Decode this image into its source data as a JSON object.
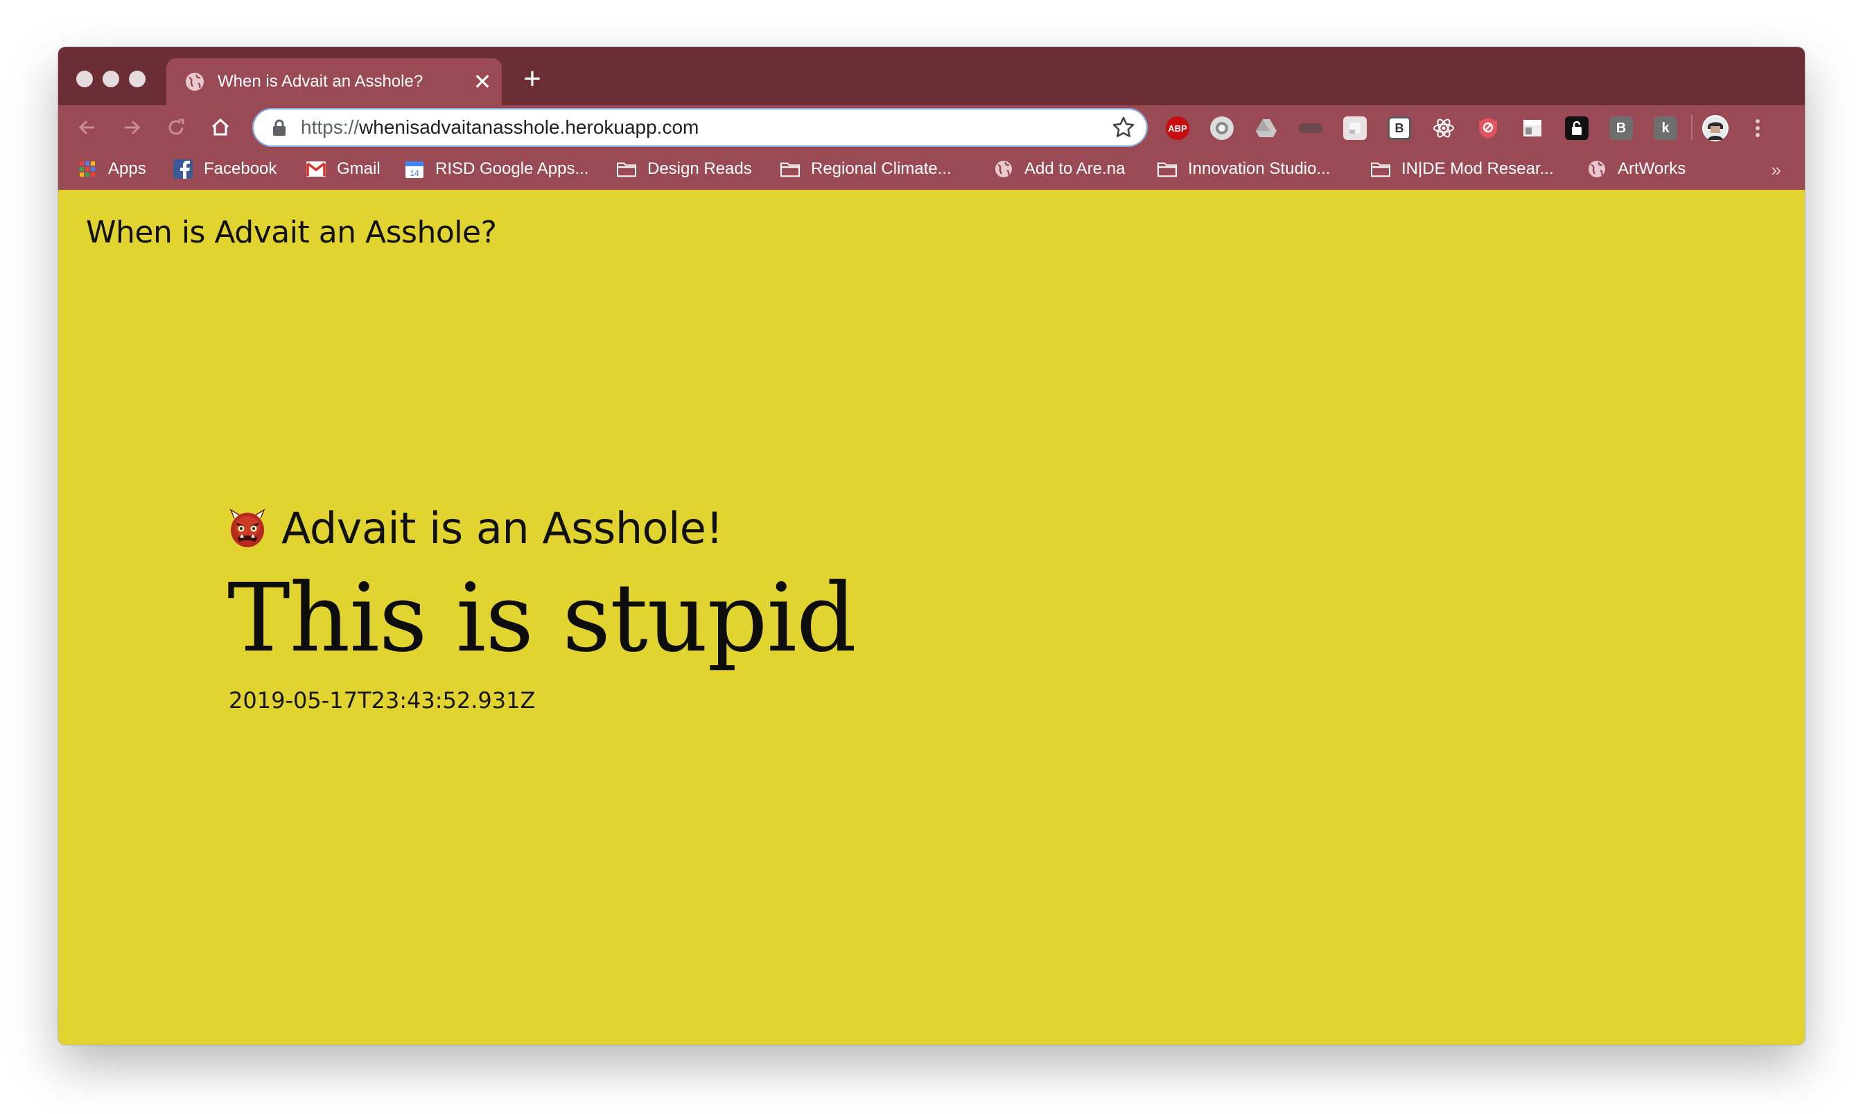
{
  "browser": {
    "tab": {
      "title": "When is Advait an Asshole?",
      "close_glyph": "✕"
    },
    "new_tab_glyph": "+",
    "address_bar": {
      "scheme": "https://",
      "host": "whenisadvaitanasshole.herokuapp.com"
    },
    "extensions": [
      {
        "name": "adblock-plus-icon",
        "label": "ABP",
        "color": "#c70d0d"
      },
      {
        "name": "extension-circle-icon",
        "label": "",
        "color": "#dcdcdc"
      },
      {
        "name": "google-drive-icon",
        "label": "",
        "color": "#bdbdbd"
      },
      {
        "name": "extension-dark-icon",
        "label": "",
        "color": "#6b4a4f"
      },
      {
        "name": "extension-notes-icon",
        "label": "",
        "color": "#e8e2e3"
      },
      {
        "name": "extension-b-box-icon",
        "label": "B",
        "color": "#e8e2e3"
      },
      {
        "name": "react-devtools-icon",
        "label": "",
        "color": "#9a4a55"
      },
      {
        "name": "shield-extension-icon",
        "label": "",
        "color": "#e5535e"
      },
      {
        "name": "extension-layout-icon",
        "label": "",
        "color": "#e8e2e3"
      },
      {
        "name": "lock-extension-icon",
        "label": "",
        "color": "#111111"
      },
      {
        "name": "extension-b-icon",
        "label": "B",
        "color": "#6e6e6e"
      },
      {
        "name": "extension-k-icon",
        "label": "k",
        "color": "#6e6e6e"
      }
    ],
    "bookmarks": [
      {
        "label": "Apps",
        "icon": "apps-grid-icon"
      },
      {
        "label": "Facebook",
        "icon": "facebook-icon"
      },
      {
        "label": "Gmail",
        "icon": "gmail-icon"
      },
      {
        "label": "RISD Google Apps...",
        "icon": "calendar-icon",
        "icon_text": "14"
      },
      {
        "label": "Design Reads",
        "icon": "folder-icon"
      },
      {
        "label": "Regional Climate...",
        "icon": "folder-icon"
      },
      {
        "label": "Add to Are.na",
        "icon": "globe-icon"
      },
      {
        "label": "Innovation Studio...",
        "icon": "folder-icon"
      },
      {
        "label": "IN|DE Mod Resear...",
        "icon": "folder-icon"
      },
      {
        "label": "ArtWorks",
        "icon": "globe-icon"
      }
    ],
    "bookmarks_overflow_glyph": "»",
    "colors": {
      "frame": "#6a2e34",
      "toolbar": "#9a4a55",
      "page_bg": "#e2d430"
    }
  },
  "page": {
    "site_title": "When is Advait an Asshole?",
    "status_emoji": "ogre-icon",
    "status": "Advait is an Asshole!",
    "message": "This is stupid",
    "timestamp": "2019-05-17T23:43:52.931Z"
  }
}
